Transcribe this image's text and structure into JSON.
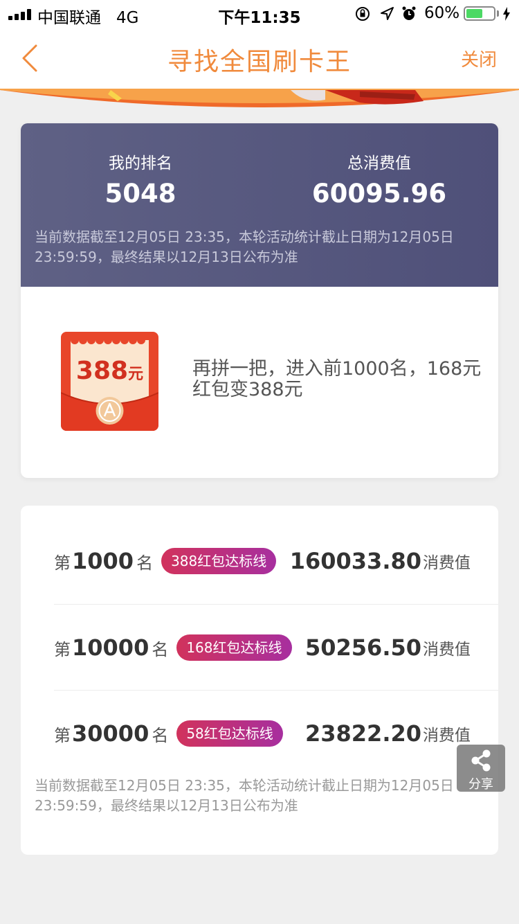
{
  "status_bar": {
    "carrier": "中国联通",
    "network": "4G",
    "time": "下午11:35",
    "battery_percent": "60%",
    "battery_level": 0.6
  },
  "nav": {
    "title": "寻找全国刷卡王",
    "close_label": "关闭"
  },
  "rank_card": {
    "my_rank_label": "我的排名",
    "my_rank_value": "5048",
    "total_label": "总消费值",
    "total_value": "60095.96",
    "note": "当前数据截至12月05日 23:35，本轮活动统计截止日期为12月05日23:59:59，最终结果以12月13日公布为准",
    "redpacket_amount": "388",
    "redpacket_unit": "元",
    "promo": "再拼一把，进入前1000名，168元红包变388元"
  },
  "thresholds": {
    "rows": [
      {
        "prefix": "第",
        "rank": "1000",
        "suffix": "名",
        "tag": "388红包达标线",
        "value": "160033.80",
        "unit": "消费值"
      },
      {
        "prefix": "第",
        "rank": "10000",
        "suffix": "名",
        "tag": "168红包达标线",
        "value": "50256.50",
        "unit": "消费值"
      },
      {
        "prefix": "第",
        "rank": "30000",
        "suffix": "名",
        "tag": "58红包达标线",
        "value": "23822.20",
        "unit": "消费值"
      }
    ],
    "note": "当前数据截至12月05日 23:35，本轮活动统计截止日期为12月05日23:59:59，最终结果以12月13日公布为准"
  },
  "share": {
    "label": "分享"
  },
  "colors": {
    "accent": "#f08a3c",
    "header_bg": "#565882",
    "tag_start": "#d1325c",
    "tag_end": "#a72f9f",
    "battery": "#4cd964"
  },
  "icons": [
    "signal-icon",
    "lock-rotation-icon",
    "location-arrow-icon",
    "alarm-icon",
    "battery-icon",
    "charging-icon",
    "back-icon",
    "share-icon",
    "red-packet-icon"
  ]
}
